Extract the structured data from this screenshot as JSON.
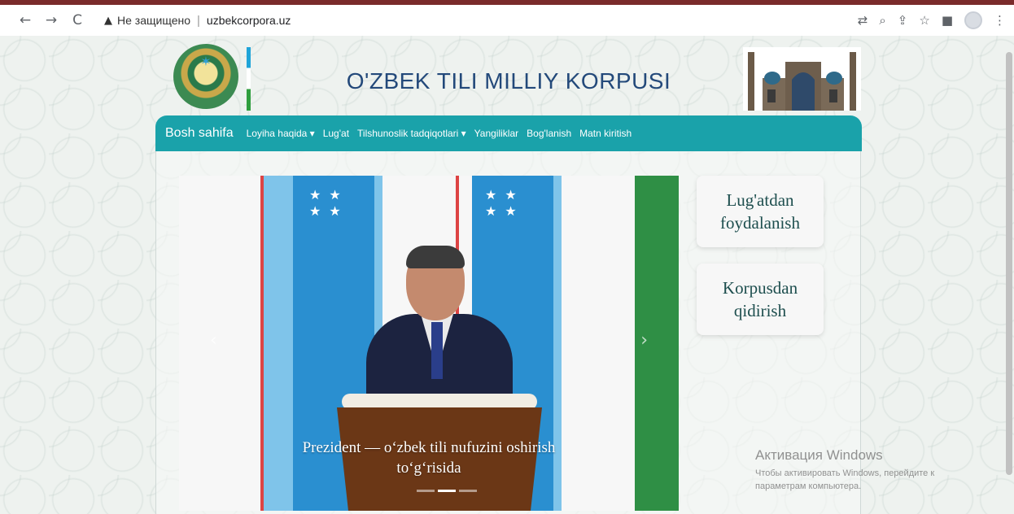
{
  "browser": {
    "back_icon": "←",
    "forward_icon": "→",
    "reload_icon": "C",
    "warning_icon": "▲",
    "security_label": "Не защищено",
    "separator": "|",
    "url": "uzbekcorpora.uz",
    "icons": [
      "translate-icon",
      "zoom-icon",
      "share-icon",
      "bookmark-star-icon",
      "sidebar-icon",
      "profile-avatar-icon",
      "more-menu-icon"
    ]
  },
  "site": {
    "title": "O'ZBEK TILI MILLIY KORPUSI",
    "nav": {
      "home": "Bosh sahifa",
      "items": [
        "Loyiha haqida ▾",
        "Lug'at",
        "Tilshunoslik tadqiqotlari ▾",
        "Yangiliklar",
        "Bog'lanish",
        "Matn kiritish"
      ]
    },
    "carousel": {
      "caption_line1": "Prezident — o‘zbek tili nufuzini oshirish",
      "caption_line2": "to‘g‘risida",
      "prev_icon": "‹",
      "next_icon": "›",
      "slide_count": 3,
      "active_slide": 1
    },
    "sidebar_buttons": [
      {
        "line1": "Lug'atdan",
        "line2": "foydalanish"
      },
      {
        "line1": "Korpusdan",
        "line2": "qidirish"
      }
    ]
  },
  "watermark": {
    "title": "Активация Windows",
    "line1": "Чтобы активировать Windows, перейдите к",
    "line2": "параметрам компьютера."
  },
  "colors": {
    "nav_bg": "#1aa2aa",
    "title": "#23497a",
    "button_text": "#1d4e4e",
    "top_strip": "#7a2b2b"
  }
}
